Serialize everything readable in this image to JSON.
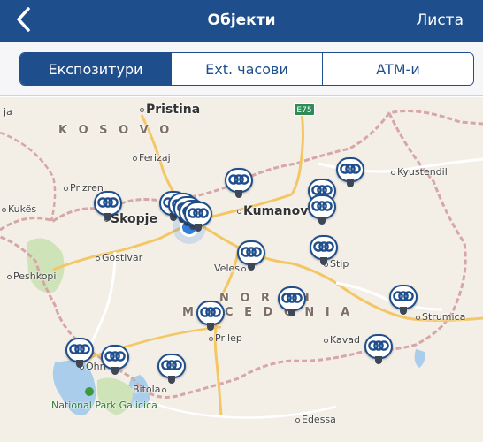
{
  "header": {
    "back_label": "<",
    "title": "Објекти",
    "list_label": "Листа"
  },
  "tabs": [
    {
      "label": "Експозитури",
      "active": true
    },
    {
      "label": "Ext. часови",
      "active": false
    },
    {
      "label": "ATM-и",
      "active": false
    }
  ],
  "map": {
    "labels": {
      "pristina": "Pristina",
      "kosovo": "K O S O V O",
      "ferizaj": "Ferizaj",
      "prizren": "Prizren",
      "kukes": "Kukës",
      "skopje": "Skopje",
      "kumanovo": "Kumanovo",
      "kyustendil": "Kyustendil",
      "gostivar": "Gostivar",
      "peshkopi": "Peshkopi",
      "veles": "Veles",
      "stip": "Stip",
      "north": "N O R T H",
      "macedonia": "M A C E D O N I A",
      "prilep": "Prilep",
      "kavadarci": "Kavad",
      "strumica": "Strumica",
      "ohrid": "Ohri",
      "bitola": "Bitola",
      "park": "National Park Galicica",
      "edessa": "Edessa",
      "ja": "ja",
      "e75": "E75"
    },
    "marker_icon": "bank-logo-icon",
    "accent_color": "#1f4e8c",
    "header_color": "#1f4e8c"
  }
}
